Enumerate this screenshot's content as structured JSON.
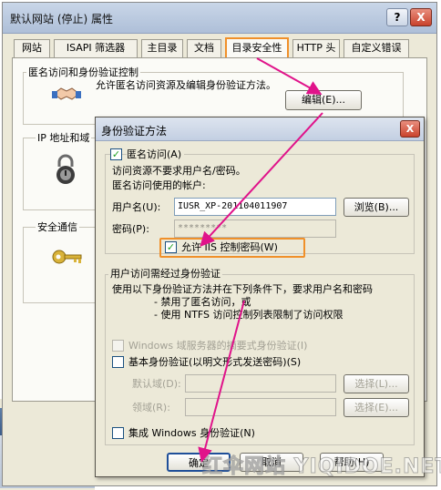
{
  "outer_window": {
    "title": "默认网站 (停止) 属性",
    "help_glyph": "?",
    "close_glyph": "X",
    "tabs": [
      "网站",
      "ISAPI 筛选器",
      "主目录",
      "文档",
      "目录安全性",
      "HTTP 头",
      "自定义错误"
    ],
    "active_tab": "目录安全性",
    "anon_section": {
      "label": "匿名访问和身份验证控制",
      "description": "允许匿名访问资源及编辑身份验证方法。",
      "edit_button": "编辑(E)..."
    },
    "ip_section": {
      "label": "IP 地址和域"
    },
    "secure_section": {
      "label": "安全通信"
    }
  },
  "auth_dialog": {
    "title": "身份验证方法",
    "close_glyph": "X",
    "anonymous_checkbox": {
      "label": "匿名访问(A)",
      "checked": true
    },
    "anon_note": "访问资源不要求用户名/密码。",
    "account_label": "匿名访问使用的帐户:",
    "username_label": "用户名(U):",
    "username_value": "IUSR_XP-201104011907",
    "browse_button": "浏览(B)...",
    "password_label": "密码(P):",
    "password_value": "*********",
    "iis_checkbox": {
      "label": "允许 IIS 控制密码(W)",
      "checked": true
    },
    "auth_group_label": "用户访问需经过身份验证",
    "auth_desc_line1": "使用以下身份验证方法并在下列条件下，要求用户名和密码",
    "auth_desc_line2": "- 禁用了匿名访问，或",
    "auth_desc_line3": "- 使用 NTFS 访问控制列表限制了访问权限",
    "digest_checkbox": {
      "label": "Windows 域服务器的摘要式身份验证(I)",
      "checked": false,
      "enabled": false
    },
    "basic_checkbox": {
      "label": "基本身份验证(以明文形式发送密码)(S)",
      "checked": false
    },
    "default_domain_label": "默认域(D):",
    "default_domain_button": "选择(L)...",
    "realm_label": "领域(R):",
    "realm_button": "选择(E)...",
    "integrated_checkbox": {
      "label": "集成 Windows 身份验证(N)",
      "checked": false
    },
    "ok_button": "确定",
    "cancel_button": "取消",
    "help_button": "帮助(H)"
  },
  "watermark_text": "红伞网站 YIQIDOE.NET",
  "colors": {
    "highlight": "#f0902a",
    "arrow": "#e0138a",
    "check": "#21a121"
  }
}
